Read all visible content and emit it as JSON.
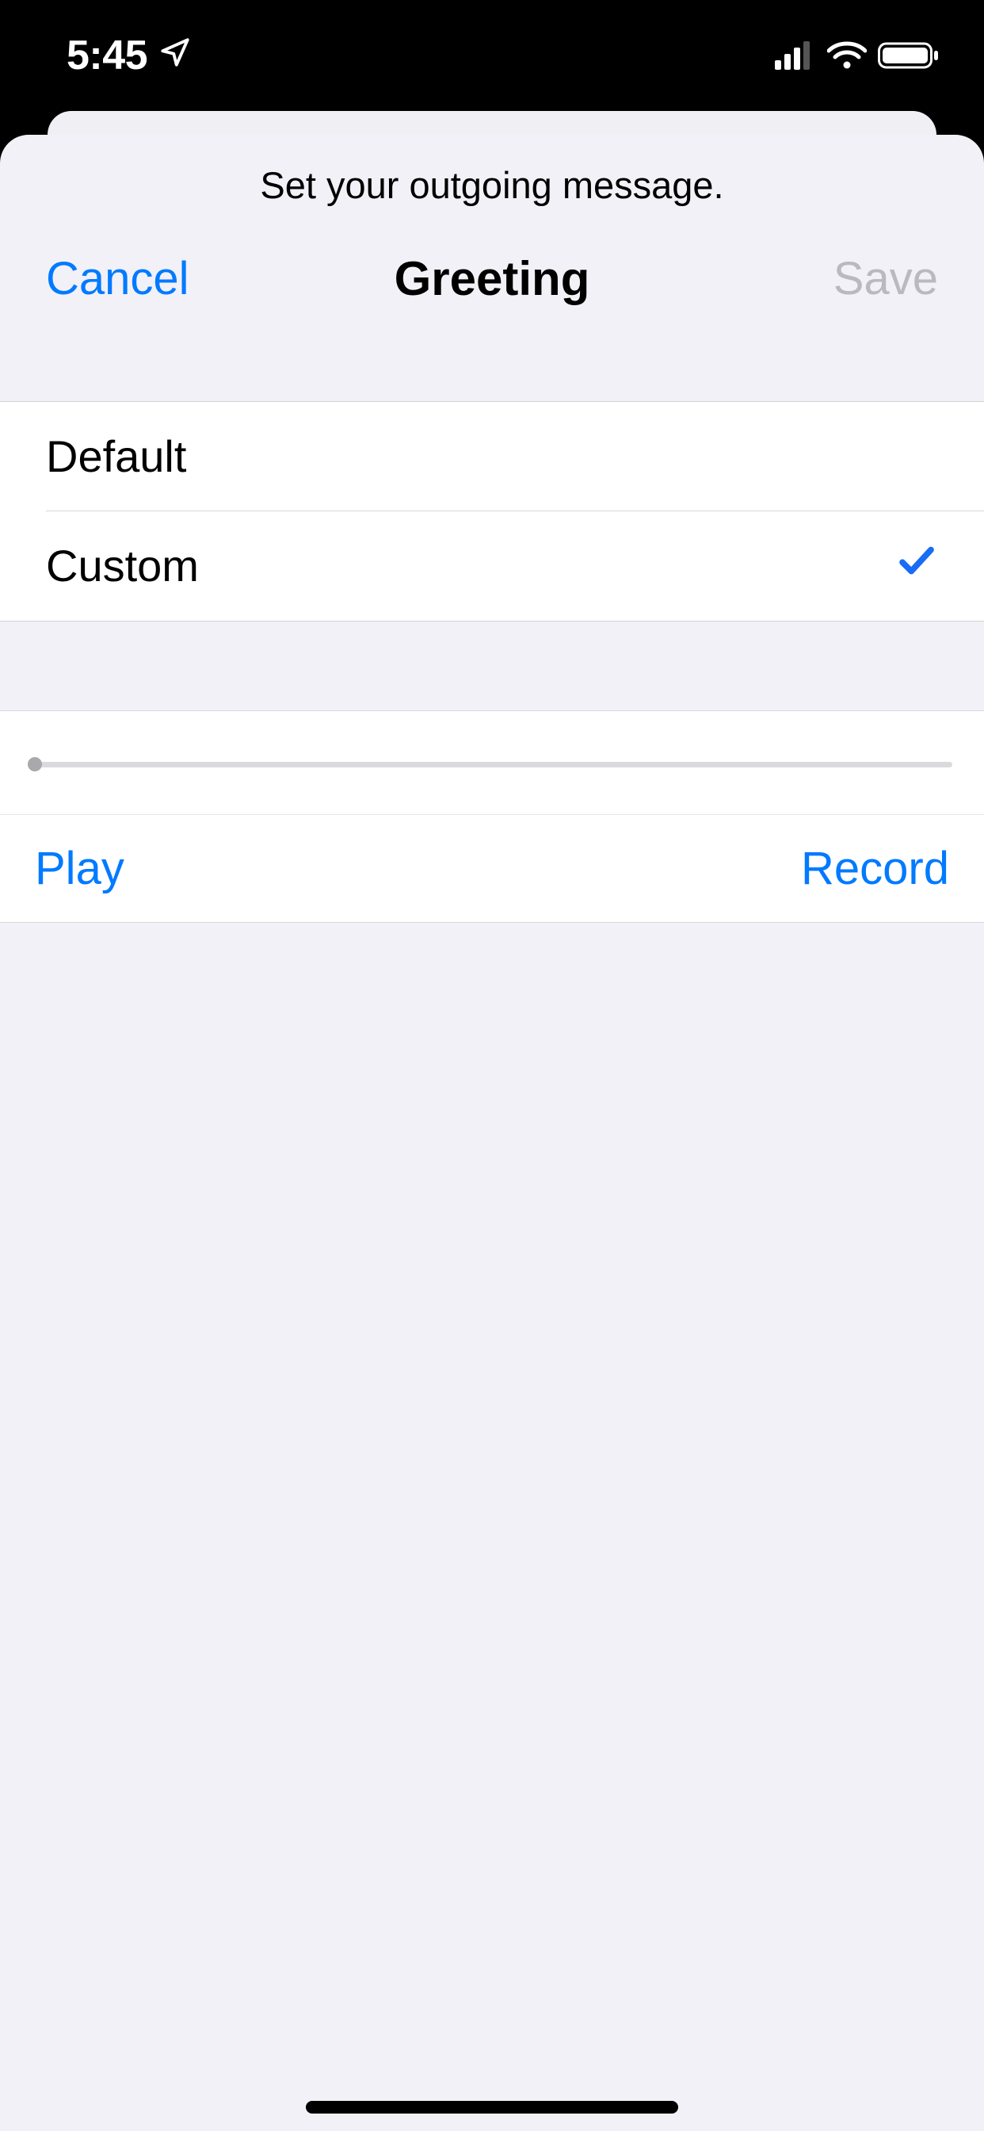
{
  "status": {
    "time": "5:45"
  },
  "sheet": {
    "subtitle": "Set your outgoing message.",
    "nav": {
      "cancel": "Cancel",
      "title": "Greeting",
      "save": "Save"
    },
    "options": {
      "default": "Default",
      "custom": "Custom"
    },
    "controls": {
      "play": "Play",
      "record": "Record"
    }
  }
}
